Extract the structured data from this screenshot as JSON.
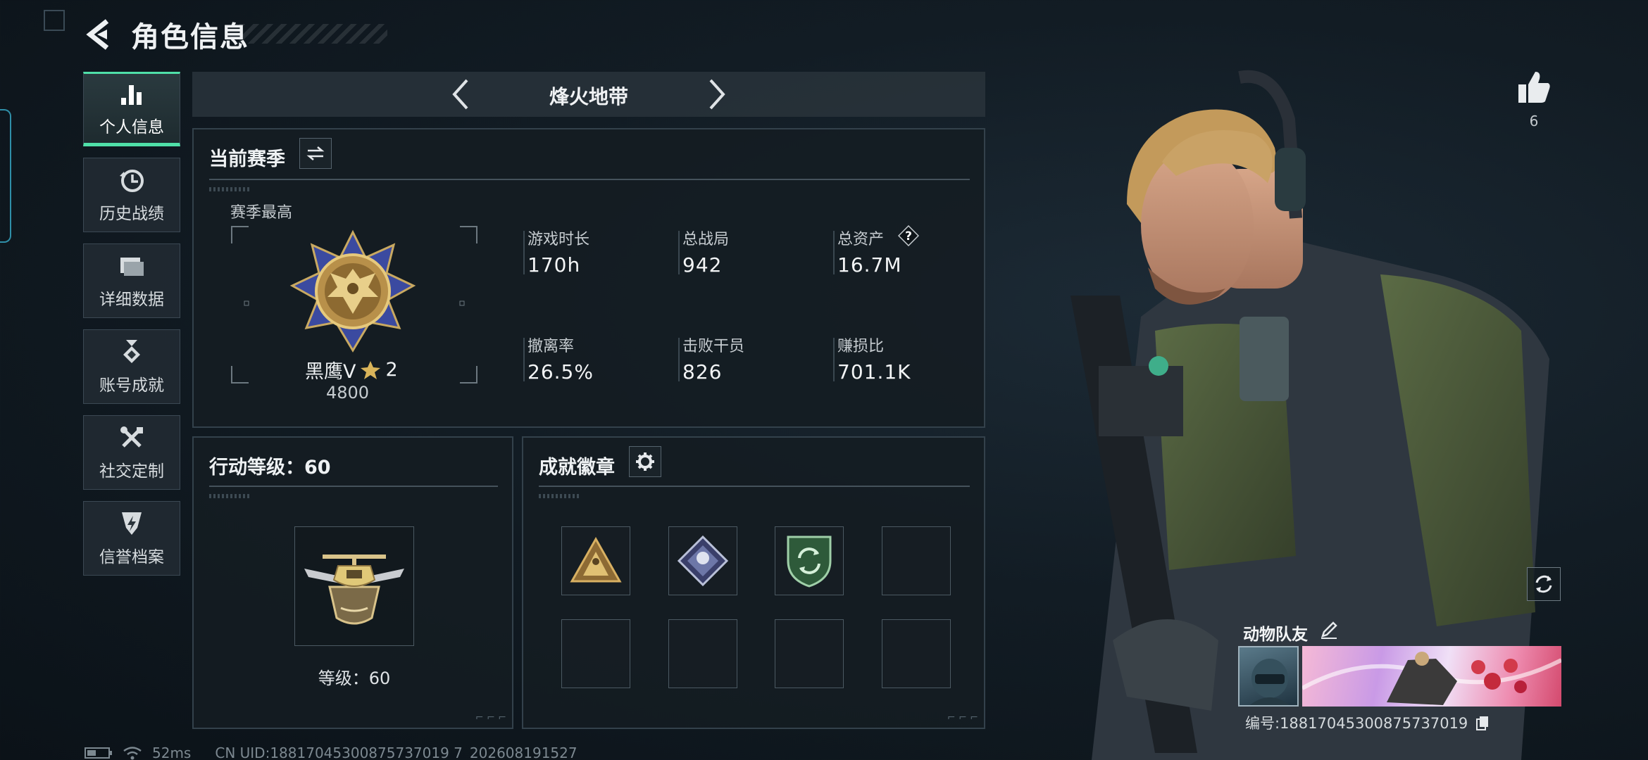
{
  "header": {
    "title": "角色信息"
  },
  "sidebar": {
    "items": [
      {
        "label": "个人信息",
        "icon": "bar-chart-icon"
      },
      {
        "label": "历史战绩",
        "icon": "history-clock-icon"
      },
      {
        "label": "详细数据",
        "icon": "folder-icon"
      },
      {
        "label": "账号成就",
        "icon": "medal-icon"
      },
      {
        "label": "社交定制",
        "icon": "tools-icon"
      },
      {
        "label": "信誉档案",
        "icon": "shield-bolt-icon"
      }
    ]
  },
  "mode": {
    "title": "烽火地带"
  },
  "season": {
    "title": "当前赛季",
    "best_label": "赛季最高",
    "rank_name": "黑鹰V",
    "rank_stars": "2",
    "rank_points": "4800",
    "stats": [
      {
        "label": "游戏时长",
        "value": "170h"
      },
      {
        "label": "总战局",
        "value": "942"
      },
      {
        "label": "总资产",
        "value": "16.7M"
      },
      {
        "label": "撤离率",
        "value": "26.5%"
      },
      {
        "label": "击败干员",
        "value": "826"
      },
      {
        "label": "赚损比",
        "value": "701.1K"
      }
    ],
    "help_symbol": "?"
  },
  "action_level": {
    "title": "行动等级：60",
    "level_label": "等级：60"
  },
  "achievements": {
    "title": "成就徽章"
  },
  "profile": {
    "likes": "6",
    "team_name": "动物队友",
    "uid_display": "编号:18817045300875737019"
  },
  "status_bar": {
    "ping": "52ms",
    "cn_uid": "CN UID:18817045300875737019 7_202608191527"
  },
  "colors": {
    "accent": "#4fe0a8",
    "panel_border": "#33414b",
    "background": "#121c24"
  }
}
